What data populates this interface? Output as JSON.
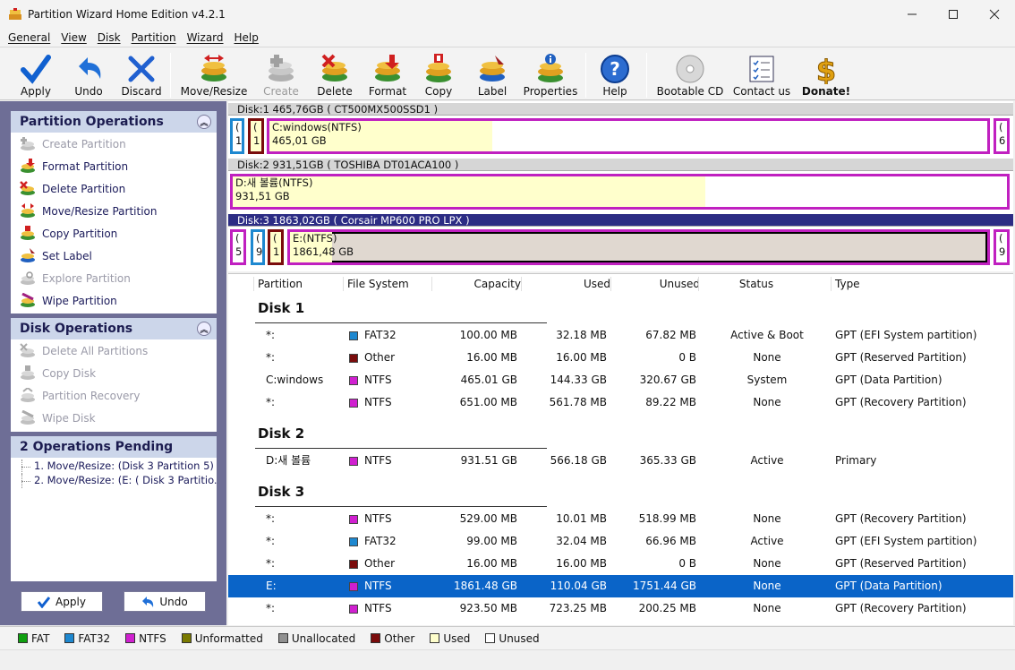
{
  "window": {
    "title": "Partition Wizard Home Edition v4.2.1"
  },
  "menu": [
    "General",
    "View",
    "Disk",
    "Partition",
    "Wizard",
    "Help"
  ],
  "toolbar": [
    {
      "label": "Apply",
      "icon": "apply-check-icon",
      "enabled": true
    },
    {
      "label": "Undo",
      "icon": "undo-arrow-icon",
      "enabled": true
    },
    {
      "label": "Discard",
      "icon": "discard-x-icon",
      "enabled": true
    },
    {
      "label": "Move/Resize",
      "icon": "move-resize-icon",
      "enabled": true
    },
    {
      "label": "Create",
      "icon": "create-partition-icon",
      "enabled": false
    },
    {
      "label": "Delete",
      "icon": "delete-partition-icon",
      "enabled": true
    },
    {
      "label": "Format",
      "icon": "format-partition-icon",
      "enabled": true
    },
    {
      "label": "Copy",
      "icon": "copy-partition-icon",
      "enabled": true
    },
    {
      "label": "Label",
      "icon": "label-icon",
      "enabled": true
    },
    {
      "label": "Properties",
      "icon": "properties-icon",
      "enabled": true
    },
    {
      "label": "Help",
      "icon": "help-question-icon",
      "enabled": true
    },
    {
      "label": "Bootable CD",
      "icon": "cd-icon",
      "enabled": true
    },
    {
      "label": "Contact us",
      "icon": "contact-checklist-icon",
      "enabled": true
    },
    {
      "label": "Donate!",
      "icon": "donate-dollar-icon",
      "enabled": true
    }
  ],
  "partition_operations": {
    "title": "Partition Operations",
    "items": [
      {
        "label": "Create Partition",
        "enabled": false
      },
      {
        "label": "Format Partition",
        "enabled": true
      },
      {
        "label": "Delete Partition",
        "enabled": true
      },
      {
        "label": "Move/Resize Partition",
        "enabled": true
      },
      {
        "label": "Copy Partition",
        "enabled": true
      },
      {
        "label": "Set Label",
        "enabled": true
      },
      {
        "label": "Explore Partition",
        "enabled": false
      },
      {
        "label": "Wipe Partition",
        "enabled": true
      }
    ]
  },
  "disk_operations": {
    "title": "Disk Operations",
    "items": [
      {
        "label": "Delete All Partitions",
        "enabled": false
      },
      {
        "label": "Copy Disk",
        "enabled": false
      },
      {
        "label": "Partition Recovery",
        "enabled": false
      },
      {
        "label": "Wipe Disk",
        "enabled": false
      }
    ]
  },
  "pending": {
    "title": "2 Operations Pending",
    "items": [
      "1. Move/Resize: (Disk 3 Partition 5)",
      "2. Move/Resize: (E: ( Disk 3 Partitio..."
    ]
  },
  "left_buttons": {
    "apply": "Apply",
    "undo": "Undo"
  },
  "diskmap": {
    "disk1": {
      "label": "Disk:1 465,76GB  ( CT500MX500SSD1 )",
      "small_a": [
        "(",
        "1"
      ],
      "small_b": [
        "(",
        "1"
      ],
      "main": [
        "C:windows(NTFS)",
        "465,01 GB"
      ],
      "tail": [
        "(",
        "6"
      ],
      "main_used_fraction": 0.31
    },
    "disk2": {
      "label": "Disk:2 931,51GB  ( TOSHIBA DT01ACA100 )",
      "main": [
        "D:새 볼륨(NTFS)",
        "931,51 GB"
      ],
      "main_used_fraction": 0.61
    },
    "disk3": {
      "label": "Disk:3 1863,02GB  ( Corsair MP600 PRO LPX )",
      "small_a": [
        "(",
        "5"
      ],
      "small_b": [
        "(",
        "9"
      ],
      "small_c": [
        "(",
        "1"
      ],
      "main": [
        "E:(NTFS)",
        "1861,48 GB"
      ],
      "tail": [
        "(",
        "9"
      ],
      "main_used_fraction": 0.06
    }
  },
  "table": {
    "columns": [
      "Partition",
      "File System",
      "Capacity",
      "Used",
      "Unused",
      "Status",
      "Type"
    ],
    "disks": [
      {
        "name": "Disk 1",
        "rows": [
          {
            "partition": "*:",
            "fs": "FAT32",
            "fs_color": "#1e88d0",
            "capacity": "100.00 MB",
            "used": "32.18 MB",
            "unused": "67.82 MB",
            "status": "Active & Boot",
            "type": "GPT (EFI System partition)"
          },
          {
            "partition": "*:",
            "fs": "Other",
            "fs_color": "#7a0c0c",
            "capacity": "16.00 MB",
            "used": "16.00 MB",
            "unused": "0 B",
            "status": "None",
            "type": "GPT (Reserved Partition)"
          },
          {
            "partition": "C:windows",
            "fs": "NTFS",
            "fs_color": "#d020d0",
            "capacity": "465.01 GB",
            "used": "144.33 GB",
            "unused": "320.67 GB",
            "status": "System",
            "type": "GPT (Data Partition)"
          },
          {
            "partition": "*:",
            "fs": "NTFS",
            "fs_color": "#d020d0",
            "capacity": "651.00 MB",
            "used": "561.78 MB",
            "unused": "89.22 MB",
            "status": "None",
            "type": "GPT (Recovery Partition)"
          }
        ]
      },
      {
        "name": "Disk 2",
        "rows": [
          {
            "partition": "D:새 볼륨",
            "fs": "NTFS",
            "fs_color": "#d020d0",
            "capacity": "931.51 GB",
            "used": "566.18 GB",
            "unused": "365.33 GB",
            "status": "Active",
            "type": "Primary"
          }
        ]
      },
      {
        "name": "Disk 3",
        "rows": [
          {
            "partition": "*:",
            "fs": "NTFS",
            "fs_color": "#d020d0",
            "capacity": "529.00 MB",
            "used": "10.01 MB",
            "unused": "518.99 MB",
            "status": "None",
            "type": "GPT (Recovery Partition)"
          },
          {
            "partition": "*:",
            "fs": "FAT32",
            "fs_color": "#1e88d0",
            "capacity": "99.00 MB",
            "used": "32.04 MB",
            "unused": "66.96 MB",
            "status": "Active",
            "type": "GPT (EFI System partition)"
          },
          {
            "partition": "*:",
            "fs": "Other",
            "fs_color": "#7a0c0c",
            "capacity": "16.00 MB",
            "used": "16.00 MB",
            "unused": "0 B",
            "status": "None",
            "type": "GPT (Reserved Partition)"
          },
          {
            "partition": "E:",
            "fs": "NTFS",
            "fs_color": "#d020d0",
            "capacity": "1861.48 GB",
            "used": "110.04 GB",
            "unused": "1751.44 GB",
            "status": "None",
            "type": "GPT (Data Partition)",
            "selected": true
          },
          {
            "partition": "*:",
            "fs": "NTFS",
            "fs_color": "#d020d0",
            "capacity": "923.50 MB",
            "used": "723.25 MB",
            "unused": "200.25 MB",
            "status": "None",
            "type": "GPT (Recovery Partition)"
          }
        ]
      }
    ]
  },
  "legend": [
    {
      "label": "FAT",
      "color": "#10a010"
    },
    {
      "label": "FAT32",
      "color": "#1e88d0"
    },
    {
      "label": "NTFS",
      "color": "#d020d0"
    },
    {
      "label": "Unformatted",
      "color": "#7a7a00"
    },
    {
      "label": "Unallocated",
      "color": "#909090"
    },
    {
      "label": "Other",
      "color": "#7a0c0c"
    },
    {
      "label": "Used",
      "color": "#ffffcc"
    },
    {
      "label": "Unused",
      "color": "#ffffff"
    }
  ],
  "colors": {
    "selection": "#0a64c8",
    "panel": "#6e6e96",
    "ntfs_border": "#c020c0",
    "fat32_border": "#1e88d0",
    "other_border": "#7a0c0c"
  }
}
